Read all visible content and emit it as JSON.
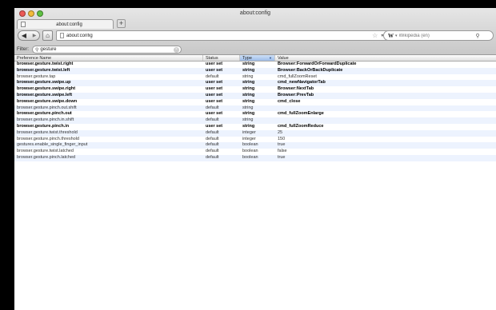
{
  "window": {
    "title": "about:config"
  },
  "tabs": [
    {
      "label": "about:config"
    }
  ],
  "newtab_label": "+",
  "navbar": {
    "url": "about:config",
    "search_placeholder": "Wikipedia (en)",
    "search_engine_glyph": "W"
  },
  "filter": {
    "label": "Filter:",
    "value": "gesture"
  },
  "table": {
    "columns": [
      "Preference Name",
      "Status",
      "Type",
      "Value"
    ],
    "sorted_column": "Type",
    "rows": [
      {
        "name": "browser.gesture.twist.right",
        "status": "user set",
        "type": "string",
        "value": "Browser:ForwardOrForwardDuplicate"
      },
      {
        "name": "browser.gesture.twist.left",
        "status": "user set",
        "type": "string",
        "value": "Browser:BackOrBackDuplicate"
      },
      {
        "name": "browser.gesture.tap",
        "status": "default",
        "type": "string",
        "value": "cmd_fullZoomReset"
      },
      {
        "name": "browser.gesture.swipe.up",
        "status": "user set",
        "type": "string",
        "value": "cmd_newNavigatorTab"
      },
      {
        "name": "browser.gesture.swipe.right",
        "status": "user set",
        "type": "string",
        "value": "Browser:NextTab"
      },
      {
        "name": "browser.gesture.swipe.left",
        "status": "user set",
        "type": "string",
        "value": "Browser:PrevTab"
      },
      {
        "name": "browser.gesture.swipe.down",
        "status": "user set",
        "type": "string",
        "value": "cmd_close"
      },
      {
        "name": "browser.gesture.pinch.out.shift",
        "status": "default",
        "type": "string",
        "value": ""
      },
      {
        "name": "browser.gesture.pinch.out",
        "status": "user set",
        "type": "string",
        "value": "cmd_fullZoomEnlarge"
      },
      {
        "name": "browser.gesture.pinch.in.shift",
        "status": "default",
        "type": "string",
        "value": ""
      },
      {
        "name": "browser.gesture.pinch.in",
        "status": "user set",
        "type": "string",
        "value": "cmd_fullZoomReduce"
      },
      {
        "name": "browser.gesture.twist.threshold",
        "status": "default",
        "type": "integer",
        "value": "25"
      },
      {
        "name": "browser.gesture.pinch.threshold",
        "status": "default",
        "type": "integer",
        "value": "150"
      },
      {
        "name": "gestures.enable_single_finger_input",
        "status": "default",
        "type": "boolean",
        "value": "true"
      },
      {
        "name": "browser.gesture.twist.latched",
        "status": "default",
        "type": "boolean",
        "value": "false"
      },
      {
        "name": "browser.gesture.pinch.latched",
        "status": "default",
        "type": "boolean",
        "value": "true"
      }
    ]
  },
  "colors": {
    "row_alt": "#edf3fe",
    "sorted_header": "#9cbce9",
    "close_light": "#ec5a55",
    "minimize_light": "#f3bb3a",
    "zoom_light": "#5fc143"
  },
  "icons": [
    "close-light",
    "minimize-light",
    "zoom-light",
    "page-icon",
    "back-arrow-icon",
    "forward-arrow-icon",
    "home-icon",
    "star-icon",
    "reload-icon",
    "wikipedia-icon",
    "search-icon",
    "clear-icon",
    "sort-icon"
  ]
}
